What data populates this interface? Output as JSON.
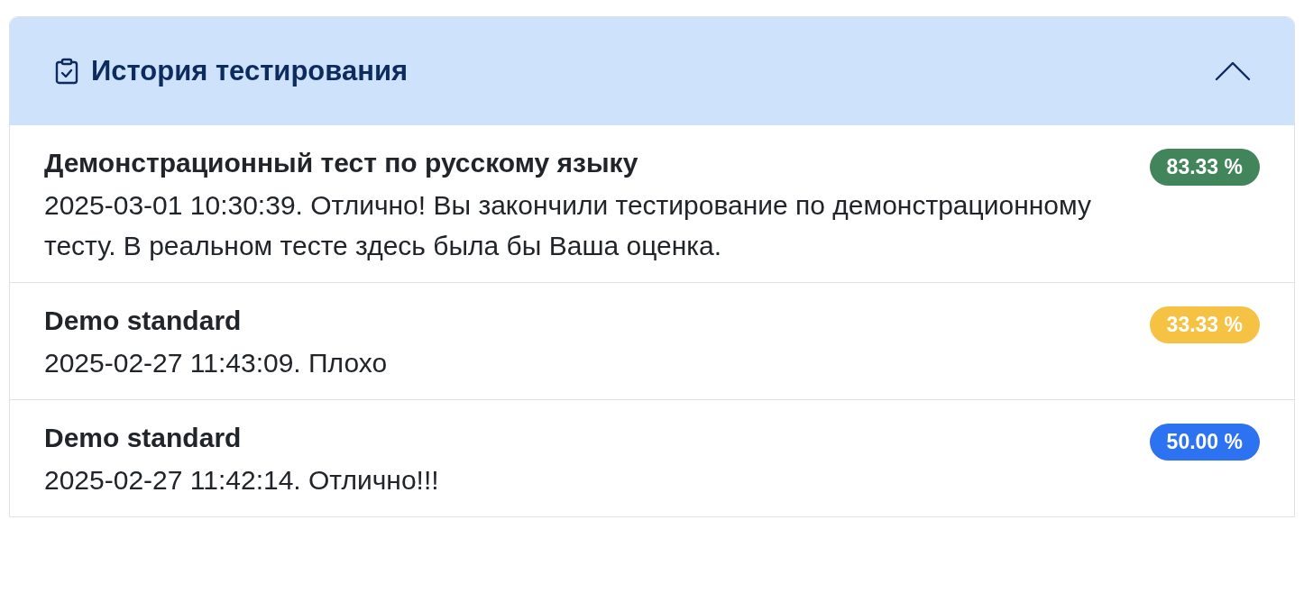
{
  "panel": {
    "title": "История тестирования",
    "expanded": true
  },
  "results": [
    {
      "title": "Демонстрационный тест по русскому языку",
      "details": "2025-03-01 10:30:39. Отлично! Вы закончили тестирование по демонстрационному тесту. В реальном тесте здесь была бы Ваша оценка.",
      "score": "83.33 %",
      "color": "#43855a"
    },
    {
      "title": "Demo standard",
      "details": "2025-02-27 11:43:09. Плохо",
      "score": "33.33 %",
      "color": "#f5c244"
    },
    {
      "title": "Demo standard",
      "details": "2025-02-27 11:42:14. Отлично!!!",
      "score": "50.00 %",
      "color": "#2d72f0"
    }
  ]
}
